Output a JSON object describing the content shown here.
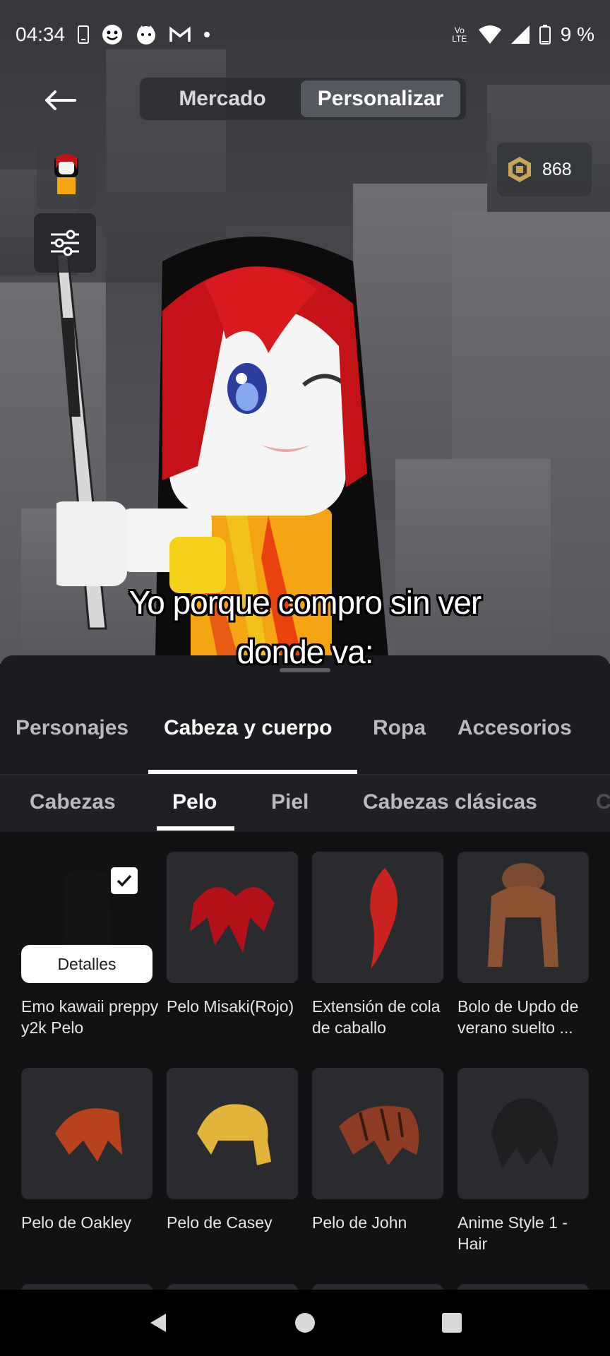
{
  "status_bar": {
    "time": "04:34",
    "notification_icons": [
      "phone-icon",
      "smiley-icon",
      "cat-icon",
      "gmail-icon",
      "dot-icon"
    ],
    "network_label": "Vo LTE",
    "battery": "9 %"
  },
  "top_nav": {
    "back_icon": "arrow-left-icon",
    "segments": [
      "Mercado",
      "Personalizar"
    ],
    "active_segment": "Personalizar"
  },
  "robux": {
    "icon": "robux-icon",
    "amount": "868"
  },
  "caption": {
    "line1": "Yo porque compro sin ver",
    "line2": "donde va:"
  },
  "category_tabs": [
    "Personajes",
    "Cabeza y cuerpo",
    "Ropa",
    "Accesorios"
  ],
  "active_category": "Cabeza y cuerpo",
  "sub_tabs": [
    "Cabezas",
    "Pelo",
    "Piel",
    "Cabezas clásicas",
    "C"
  ],
  "active_sub_tab": "Pelo",
  "items": [
    {
      "name": "Emo kawaii preppy y2k Pelo",
      "selected": true,
      "color": "#151517"
    },
    {
      "name": "Pelo Misaki(Rojo)",
      "selected": false,
      "color": "#b3121a"
    },
    {
      "name": "Extensión de cola de caballo",
      "selected": false,
      "color": "#c8231f"
    },
    {
      "name": "Bolo de Updo de verano suelto ...",
      "selected": false,
      "color": "#7a4a2e"
    },
    {
      "name": "Pelo de Oakley",
      "selected": false,
      "color": "#b8421e"
    },
    {
      "name": "Pelo de Casey",
      "selected": false,
      "color": "#e2b43a"
    },
    {
      "name": "Pelo de John",
      "selected": false,
      "color": "#8d3b22"
    },
    {
      "name": "Anime Style 1 - Hair",
      "selected": false,
      "color": "#1e1f21"
    }
  ],
  "details_button": "Detalles",
  "system_nav": [
    "back-triangle-icon",
    "home-circle-icon",
    "recents-square-icon"
  ]
}
